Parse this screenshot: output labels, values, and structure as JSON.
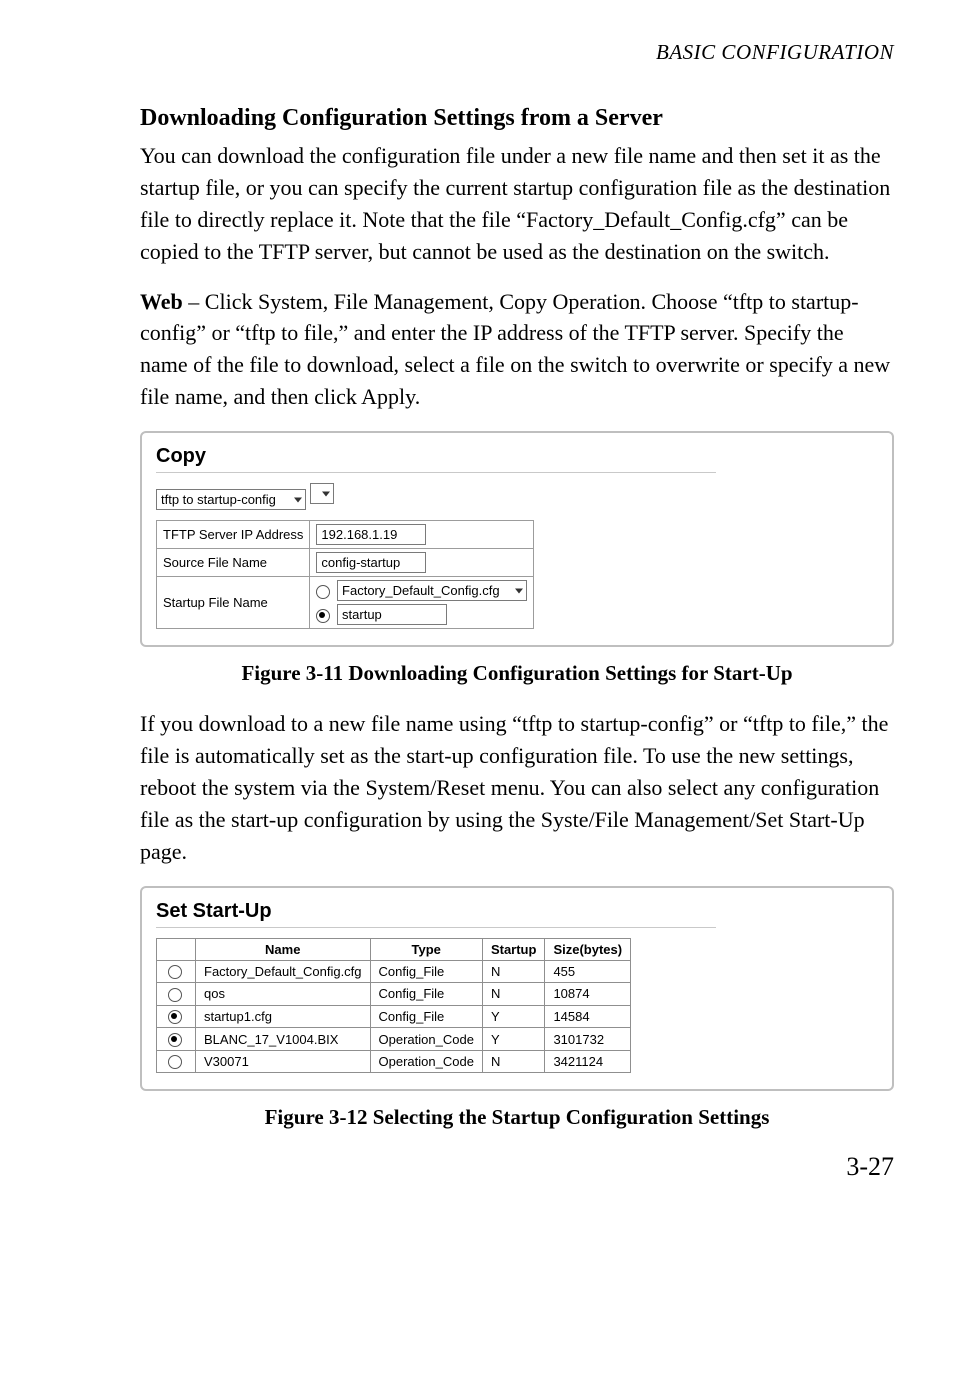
{
  "runningHead": "BASIC CONFIGURATION",
  "section": {
    "title": "Downloading Configuration Settings from a Server",
    "para1": "You can download the configuration file under a new file name and then set it as the startup file, or you can specify the current startup configuration file as the destination file to directly replace it. Note that the file “Factory_Default_Config.cfg” can be copied to the TFTP server, but cannot be used as the destination on the switch.",
    "para2_bold": "Web",
    "para2_rest": " – Click System, File Management, Copy Operation. Choose “tftp to startup-config” or “tftp to file,” and enter the IP address of the TFTP server. Specify the name of the file to download, select a file on the switch to overwrite or specify a new file name, and then click Apply.",
    "para3": "If you download to a new file name using “tftp to startup-config” or “tftp to file,” the file is automatically set as the start-up configuration file. To use the new settings, reboot the system via the System/Reset menu. You can also select any configuration file as the start-up configuration by using the Syste/File Management/Set Start-Up page."
  },
  "figure1": {
    "title": "Copy",
    "modeSelected": "tftp to startup-config",
    "rows": {
      "tftpLabel": "TFTP Server IP Address",
      "tftpValue": "192.168.1.19",
      "sourceLabel": "Source File Name",
      "sourceValue": "config-startup",
      "startupLabel": "Startup File Name",
      "opt1": "Factory_Default_Config.cfg",
      "opt2": "startup"
    },
    "caption": "Figure 3-11  Downloading Configuration Settings for Start-Up"
  },
  "figure2": {
    "title": "Set Start-Up",
    "headers": {
      "name": "Name",
      "type": "Type",
      "startup": "Startup",
      "size": "Size(bytes)"
    },
    "rows": [
      {
        "sel": false,
        "name": "Factory_Default_Config.cfg",
        "type": "Config_File",
        "startup": "N",
        "size": "455"
      },
      {
        "sel": false,
        "name": "qos",
        "type": "Config_File",
        "startup": "N",
        "size": "10874"
      },
      {
        "sel": true,
        "name": "startup1.cfg",
        "type": "Config_File",
        "startup": "Y",
        "size": "14584"
      },
      {
        "sel": true,
        "name": "BLANC_17_V1004.BIX",
        "type": "Operation_Code",
        "startup": "Y",
        "size": "3101732"
      },
      {
        "sel": false,
        "name": "V30071",
        "type": "Operation_Code",
        "startup": "N",
        "size": "3421124"
      }
    ],
    "caption": "Figure 3-12  Selecting the Startup Configuration Settings"
  },
  "pageNumber": "3-27"
}
